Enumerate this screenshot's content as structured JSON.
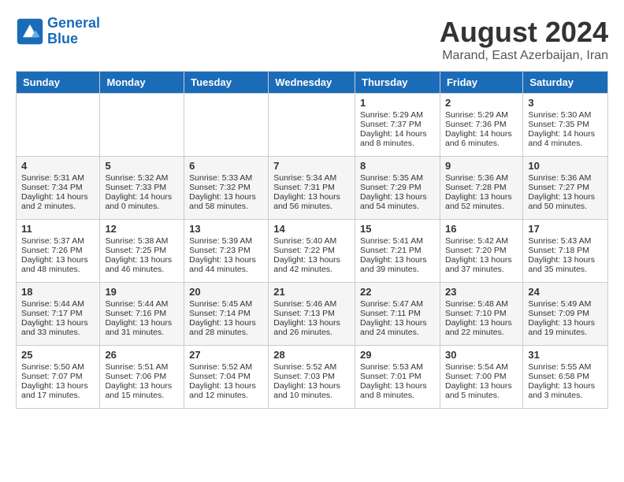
{
  "header": {
    "logo_line1": "General",
    "logo_line2": "Blue",
    "month_year": "August 2024",
    "location": "Marand, East Azerbaijan, Iran"
  },
  "days_of_week": [
    "Sunday",
    "Monday",
    "Tuesday",
    "Wednesday",
    "Thursday",
    "Friday",
    "Saturday"
  ],
  "weeks": [
    [
      {
        "day": "",
        "content": ""
      },
      {
        "day": "",
        "content": ""
      },
      {
        "day": "",
        "content": ""
      },
      {
        "day": "",
        "content": ""
      },
      {
        "day": "1",
        "content": "Sunrise: 5:29 AM\nSunset: 7:37 PM\nDaylight: 14 hours\nand 8 minutes."
      },
      {
        "day": "2",
        "content": "Sunrise: 5:29 AM\nSunset: 7:36 PM\nDaylight: 14 hours\nand 6 minutes."
      },
      {
        "day": "3",
        "content": "Sunrise: 5:30 AM\nSunset: 7:35 PM\nDaylight: 14 hours\nand 4 minutes."
      }
    ],
    [
      {
        "day": "4",
        "content": "Sunrise: 5:31 AM\nSunset: 7:34 PM\nDaylight: 14 hours\nand 2 minutes."
      },
      {
        "day": "5",
        "content": "Sunrise: 5:32 AM\nSunset: 7:33 PM\nDaylight: 14 hours\nand 0 minutes."
      },
      {
        "day": "6",
        "content": "Sunrise: 5:33 AM\nSunset: 7:32 PM\nDaylight: 13 hours\nand 58 minutes."
      },
      {
        "day": "7",
        "content": "Sunrise: 5:34 AM\nSunset: 7:31 PM\nDaylight: 13 hours\nand 56 minutes."
      },
      {
        "day": "8",
        "content": "Sunrise: 5:35 AM\nSunset: 7:29 PM\nDaylight: 13 hours\nand 54 minutes."
      },
      {
        "day": "9",
        "content": "Sunrise: 5:36 AM\nSunset: 7:28 PM\nDaylight: 13 hours\nand 52 minutes."
      },
      {
        "day": "10",
        "content": "Sunrise: 5:36 AM\nSunset: 7:27 PM\nDaylight: 13 hours\nand 50 minutes."
      }
    ],
    [
      {
        "day": "11",
        "content": "Sunrise: 5:37 AM\nSunset: 7:26 PM\nDaylight: 13 hours\nand 48 minutes."
      },
      {
        "day": "12",
        "content": "Sunrise: 5:38 AM\nSunset: 7:25 PM\nDaylight: 13 hours\nand 46 minutes."
      },
      {
        "day": "13",
        "content": "Sunrise: 5:39 AM\nSunset: 7:23 PM\nDaylight: 13 hours\nand 44 minutes."
      },
      {
        "day": "14",
        "content": "Sunrise: 5:40 AM\nSunset: 7:22 PM\nDaylight: 13 hours\nand 42 minutes."
      },
      {
        "day": "15",
        "content": "Sunrise: 5:41 AM\nSunset: 7:21 PM\nDaylight: 13 hours\nand 39 minutes."
      },
      {
        "day": "16",
        "content": "Sunrise: 5:42 AM\nSunset: 7:20 PM\nDaylight: 13 hours\nand 37 minutes."
      },
      {
        "day": "17",
        "content": "Sunrise: 5:43 AM\nSunset: 7:18 PM\nDaylight: 13 hours\nand 35 minutes."
      }
    ],
    [
      {
        "day": "18",
        "content": "Sunrise: 5:44 AM\nSunset: 7:17 PM\nDaylight: 13 hours\nand 33 minutes."
      },
      {
        "day": "19",
        "content": "Sunrise: 5:44 AM\nSunset: 7:16 PM\nDaylight: 13 hours\nand 31 minutes."
      },
      {
        "day": "20",
        "content": "Sunrise: 5:45 AM\nSunset: 7:14 PM\nDaylight: 13 hours\nand 28 minutes."
      },
      {
        "day": "21",
        "content": "Sunrise: 5:46 AM\nSunset: 7:13 PM\nDaylight: 13 hours\nand 26 minutes."
      },
      {
        "day": "22",
        "content": "Sunrise: 5:47 AM\nSunset: 7:11 PM\nDaylight: 13 hours\nand 24 minutes."
      },
      {
        "day": "23",
        "content": "Sunrise: 5:48 AM\nSunset: 7:10 PM\nDaylight: 13 hours\nand 22 minutes."
      },
      {
        "day": "24",
        "content": "Sunrise: 5:49 AM\nSunset: 7:09 PM\nDaylight: 13 hours\nand 19 minutes."
      }
    ],
    [
      {
        "day": "25",
        "content": "Sunrise: 5:50 AM\nSunset: 7:07 PM\nDaylight: 13 hours\nand 17 minutes."
      },
      {
        "day": "26",
        "content": "Sunrise: 5:51 AM\nSunset: 7:06 PM\nDaylight: 13 hours\nand 15 minutes."
      },
      {
        "day": "27",
        "content": "Sunrise: 5:52 AM\nSunset: 7:04 PM\nDaylight: 13 hours\nand 12 minutes."
      },
      {
        "day": "28",
        "content": "Sunrise: 5:52 AM\nSunset: 7:03 PM\nDaylight: 13 hours\nand 10 minutes."
      },
      {
        "day": "29",
        "content": "Sunrise: 5:53 AM\nSunset: 7:01 PM\nDaylight: 13 hours\nand 8 minutes."
      },
      {
        "day": "30",
        "content": "Sunrise: 5:54 AM\nSunset: 7:00 PM\nDaylight: 13 hours\nand 5 minutes."
      },
      {
        "day": "31",
        "content": "Sunrise: 5:55 AM\nSunset: 6:58 PM\nDaylight: 13 hours\nand 3 minutes."
      }
    ]
  ]
}
